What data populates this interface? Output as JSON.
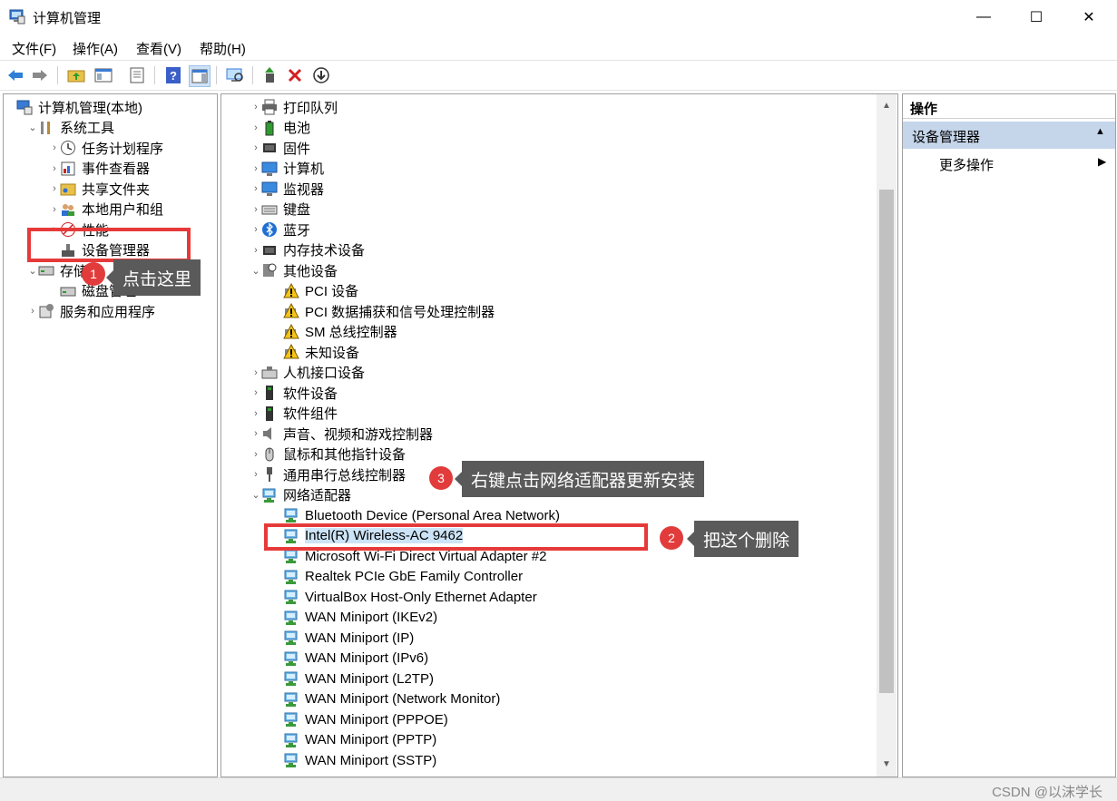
{
  "window": {
    "title": "计算机管理",
    "minimize": "—",
    "maximize": "☐",
    "close": "✕"
  },
  "menu": [
    "文件(F)",
    "操作(A)",
    "查看(V)",
    "帮助(H)"
  ],
  "left_tree": [
    {
      "label": "计算机管理(本地)",
      "icon": "computer-mgmt-icon",
      "level": 0,
      "chevron": ""
    },
    {
      "label": "系统工具",
      "icon": "tools-icon",
      "level": 1,
      "chevron": "⌄"
    },
    {
      "label": "任务计划程序",
      "icon": "clock-icon",
      "level": 2,
      "chevron": "›"
    },
    {
      "label": "事件查看器",
      "icon": "event-viewer-icon",
      "level": 2,
      "chevron": "›"
    },
    {
      "label": "共享文件夹",
      "icon": "shared-folder-icon",
      "level": 2,
      "chevron": "›"
    },
    {
      "label": "本地用户和组",
      "icon": "users-icon",
      "level": 2,
      "chevron": "›"
    },
    {
      "label": "性能",
      "icon": "performance-icon",
      "level": 2,
      "chevron": "›"
    },
    {
      "label": "设备管理器",
      "icon": "device-manager-icon",
      "level": 2,
      "chevron": ""
    },
    {
      "label": "存储",
      "icon": "storage-icon",
      "level": 1,
      "chevron": "⌄"
    },
    {
      "label": "磁盘管理",
      "icon": "disk-icon",
      "level": 2,
      "chevron": ""
    },
    {
      "label": "服务和应用程序",
      "icon": "services-icon",
      "level": 1,
      "chevron": "›"
    }
  ],
  "device_tree": [
    {
      "label": "打印队列",
      "icon": "printer-icon",
      "level": 0,
      "chevron": "›"
    },
    {
      "label": "电池",
      "icon": "battery-icon",
      "level": 0,
      "chevron": "›"
    },
    {
      "label": "固件",
      "icon": "firmware-icon",
      "level": 0,
      "chevron": "›"
    },
    {
      "label": "计算机",
      "icon": "monitor-icon",
      "level": 0,
      "chevron": "›"
    },
    {
      "label": "监视器",
      "icon": "monitor-icon",
      "level": 0,
      "chevron": "›"
    },
    {
      "label": "键盘",
      "icon": "keyboard-icon",
      "level": 0,
      "chevron": "›"
    },
    {
      "label": "蓝牙",
      "icon": "bluetooth-icon",
      "level": 0,
      "chevron": "›"
    },
    {
      "label": "内存技术设备",
      "icon": "memory-icon",
      "level": 0,
      "chevron": "›"
    },
    {
      "label": "其他设备",
      "icon": "other-devices-icon",
      "level": 0,
      "chevron": "⌄"
    },
    {
      "label": "PCI 设备",
      "icon": "warning-device-icon",
      "level": 1,
      "chevron": ""
    },
    {
      "label": "PCI 数据捕获和信号处理控制器",
      "icon": "warning-device-icon",
      "level": 1,
      "chevron": ""
    },
    {
      "label": "SM 总线控制器",
      "icon": "warning-device-icon",
      "level": 1,
      "chevron": ""
    },
    {
      "label": "未知设备",
      "icon": "warning-device-icon",
      "level": 1,
      "chevron": ""
    },
    {
      "label": "人机接口设备",
      "icon": "hid-icon",
      "level": 0,
      "chevron": "›"
    },
    {
      "label": "软件设备",
      "icon": "software-device-icon",
      "level": 0,
      "chevron": "›"
    },
    {
      "label": "软件组件",
      "icon": "software-device-icon",
      "level": 0,
      "chevron": "›"
    },
    {
      "label": "声音、视频和游戏控制器",
      "icon": "speaker-icon",
      "level": 0,
      "chevron": "›"
    },
    {
      "label": "鼠标和其他指针设备",
      "icon": "mouse-icon",
      "level": 0,
      "chevron": "›"
    },
    {
      "label": "通用串行总线控制器",
      "icon": "usb-icon",
      "level": 0,
      "chevron": "›"
    },
    {
      "label": "网络适配器",
      "icon": "network-adapter-icon",
      "level": 0,
      "chevron": "⌄"
    },
    {
      "label": "Bluetooth Device (Personal Area Network)",
      "icon": "network-adapter-icon",
      "level": 1,
      "chevron": ""
    },
    {
      "label": "Intel(R) Wireless-AC 9462",
      "icon": "network-adapter-icon",
      "level": 1,
      "chevron": "",
      "selected": true
    },
    {
      "label": "Microsoft Wi-Fi Direct Virtual Adapter #2",
      "icon": "network-adapter-icon",
      "level": 1,
      "chevron": ""
    },
    {
      "label": "Realtek PCIe GbE Family Controller",
      "icon": "network-adapter-icon",
      "level": 1,
      "chevron": ""
    },
    {
      "label": "VirtualBox Host-Only Ethernet Adapter",
      "icon": "network-adapter-icon",
      "level": 1,
      "chevron": ""
    },
    {
      "label": "WAN Miniport (IKEv2)",
      "icon": "network-adapter-icon",
      "level": 1,
      "chevron": ""
    },
    {
      "label": "WAN Miniport (IP)",
      "icon": "network-adapter-icon",
      "level": 1,
      "chevron": ""
    },
    {
      "label": "WAN Miniport (IPv6)",
      "icon": "network-adapter-icon",
      "level": 1,
      "chevron": ""
    },
    {
      "label": "WAN Miniport (L2TP)",
      "icon": "network-adapter-icon",
      "level": 1,
      "chevron": ""
    },
    {
      "label": "WAN Miniport (Network Monitor)",
      "icon": "network-adapter-icon",
      "level": 1,
      "chevron": ""
    },
    {
      "label": "WAN Miniport (PPPOE)",
      "icon": "network-adapter-icon",
      "level": 1,
      "chevron": ""
    },
    {
      "label": "WAN Miniport (PPTP)",
      "icon": "network-adapter-icon",
      "level": 1,
      "chevron": ""
    },
    {
      "label": "WAN Miniport (SSTP)",
      "icon": "network-adapter-icon",
      "level": 1,
      "chevron": ""
    }
  ],
  "actions": {
    "header": "操作",
    "section": "设备管理器",
    "more": "更多操作"
  },
  "annotations": [
    {
      "number": "1",
      "text": "点击这里"
    },
    {
      "number": "2",
      "text": "把这个删除"
    },
    {
      "number": "3",
      "text": "右键点击网络适配器更新安装"
    }
  ],
  "watermark": "CSDN @以沫学长",
  "colors": {
    "highlight": "#e63a3a",
    "selection": "#cce4f7",
    "action_section": "#c5d5ea",
    "callout": "#5a5a5a"
  }
}
